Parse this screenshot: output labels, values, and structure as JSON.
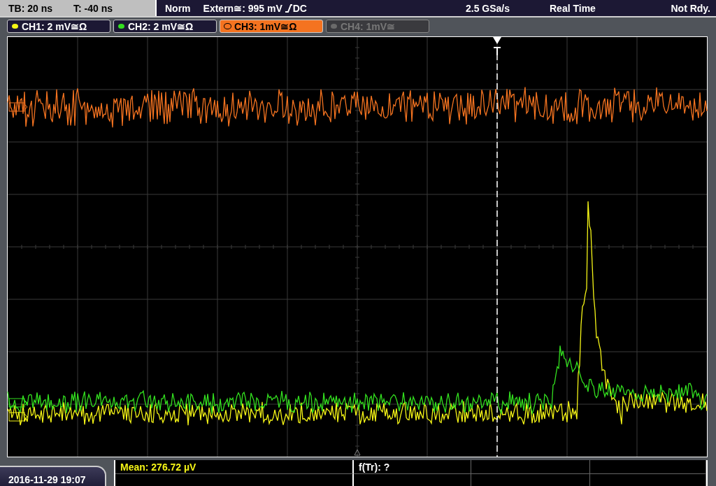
{
  "status_bar": {
    "timebase": "TB: 20 ns",
    "trigger_time": "T: -40 ns",
    "trigger_mode": "Norm",
    "trigger_source": "Extern≅: 995 mV",
    "coupling": "DC",
    "sample_rate": "2.5 GSa/s",
    "acquisition": "Real Time",
    "state": "Not Rdy."
  },
  "channels": [
    {
      "label": "CH1: 2 mV≅Ω",
      "color": "#f5f516",
      "selected": false,
      "on": true
    },
    {
      "label": "CH2: 2 mV≅Ω",
      "color": "#33e01f",
      "selected": false,
      "on": true
    },
    {
      "label": "CH3: 1mV≅Ω",
      "color": "#f47320",
      "selected": true,
      "on": true
    },
    {
      "label": "CH4: 1mV≅",
      "color": "#6a6a6a",
      "selected": false,
      "on": false
    }
  ],
  "measurements": [
    {
      "text": "Mean: 276.72 µV",
      "kind": "channel"
    },
    {
      "text": "f(Tr): ?",
      "kind": "trigger"
    }
  ],
  "timestamp": "2016-11-29 19:07"
}
